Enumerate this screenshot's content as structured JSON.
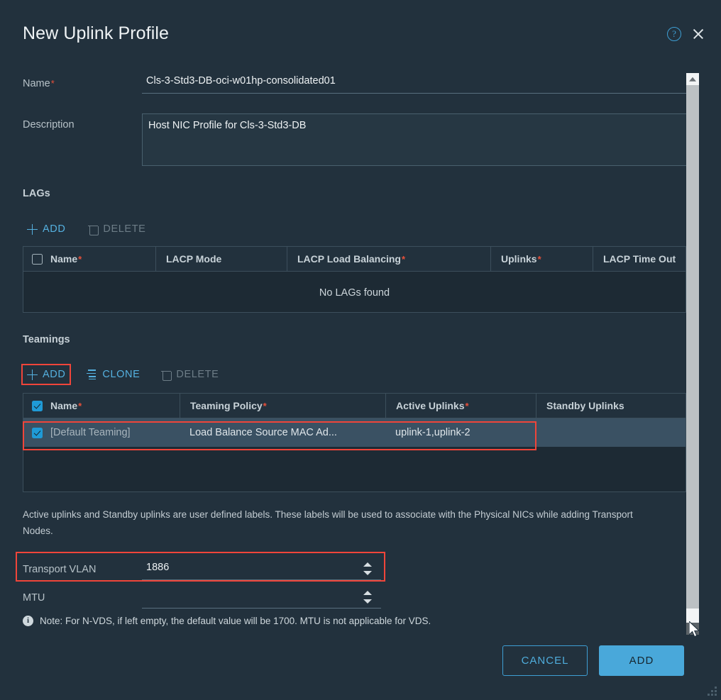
{
  "dialog": {
    "title": "New Uplink Profile",
    "help_icon": "help-circle-icon",
    "close_icon": "close-icon"
  },
  "form": {
    "name_label": "Name",
    "name_value": "Cls-3-Std3-DB-oci-w01hp-consolidated01",
    "description_label": "Description",
    "description_value": "Host NIC Profile for Cls-3-Std3-DB"
  },
  "lags": {
    "section_title": "LAGs",
    "toolbar": {
      "add_label": "ADD",
      "delete_label": "DELETE"
    },
    "columns": [
      "Name",
      "LACP Mode",
      "LACP Load Balancing",
      "Uplinks",
      "LACP Time Out"
    ],
    "required_columns": [
      "Name",
      "LACP Load Balancing",
      "Uplinks"
    ],
    "empty_message": "No LAGs found"
  },
  "teamings": {
    "section_title": "Teamings",
    "toolbar": {
      "add_label": "ADD",
      "clone_label": "CLONE",
      "delete_label": "DELETE"
    },
    "columns": [
      "Name",
      "Teaming Policy",
      "Active Uplinks",
      "Standby Uplinks"
    ],
    "required_columns": [
      "Name",
      "Teaming Policy",
      "Active Uplinks"
    ],
    "rows": [
      {
        "selected": true,
        "name": "[Default Teaming]",
        "teaming_policy": "Load Balance Source MAC Ad...",
        "active_uplinks": "uplink-1,uplink-2",
        "standby_uplinks": ""
      }
    ],
    "helper_text": "Active uplinks and Standby uplinks are user defined labels. These labels will be used to associate with the Physical NICs while adding Transport Nodes."
  },
  "transport_vlan": {
    "label": "Transport VLAN",
    "value": "1886"
  },
  "mtu": {
    "label": "MTU",
    "value": "",
    "note_icon": "info-icon",
    "note": "Note: For N-VDS, if left empty, the default value will be 1700. MTU is not applicable for VDS."
  },
  "footer": {
    "cancel_label": "CANCEL",
    "add_label": "ADD"
  },
  "colors": {
    "accent": "#49a8da",
    "link": "#55b1e0",
    "highlight": "#f0453a",
    "required": "#e8503a",
    "dialog_bg": "#22313d",
    "row_selected": "#3a5163"
  }
}
